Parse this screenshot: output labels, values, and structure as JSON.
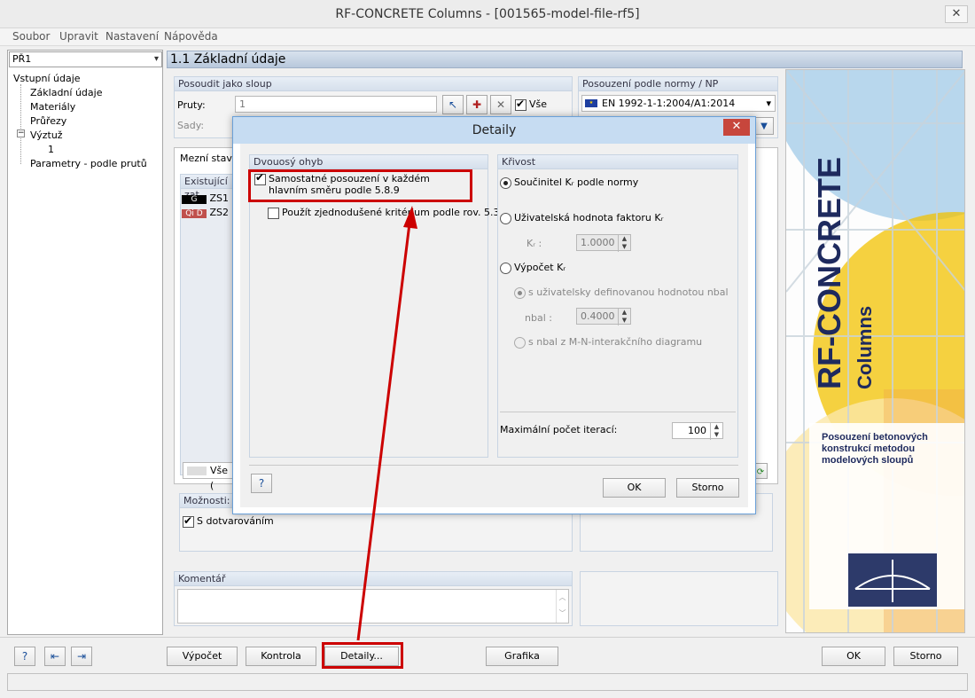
{
  "window": {
    "title": "RF-CONCRETE Columns - [001565-model-file-rf5]",
    "close_glyph": "✕"
  },
  "menu": [
    "Soubor",
    "Upravit",
    "Nastavení",
    "Nápověda"
  ],
  "left": {
    "case_select": "PŘ1",
    "tree": {
      "root": "Vstupní údaje",
      "basic": "Základní údaje",
      "materials": "Materiály",
      "sections": "Průřezy",
      "reinforcement": "Výztuž",
      "reinf_child": "1",
      "params": "Parametry - podle prutů"
    }
  },
  "main": {
    "header": "1.1 Základní údaje",
    "design_group": {
      "title": "Posoudit jako sloup",
      "members_label": "Pruty:",
      "members_value": "1",
      "sets_label": "Sady:",
      "all_label": "Vše"
    },
    "norm_group": {
      "title": "Posouzení podle normy / NP",
      "norm_value": "EN 1992-1-1:2004/A1:2014"
    },
    "tab_label": "Mezní stav ú",
    "existing_label": "Existující zat",
    "load_cases": [
      {
        "tag": "G",
        "name": "ZS1",
        "tag_color": "#000000"
      },
      {
        "tag": "Qi D",
        "name": "ZS2",
        "tag_color": "#c0504d"
      }
    ],
    "all_short": "Vše (",
    "options_title": "Možnosti:",
    "creep_label": "S dotvarováním",
    "comment_title": "Komentář"
  },
  "graphic": {
    "brand": "RF-CONCRETE",
    "sub": "Columns",
    "description": "Posouzení betonových konstrukcí metodou modelových sloupů"
  },
  "dialog": {
    "title": "Detaily",
    "close_glyph": "✕",
    "biaxial": {
      "title": "Dvouosý ohyb",
      "separate_label": "Samostatné posouzení v každém hlavním směru podle 5.8.9",
      "simplified_label": "Použít zjednodušené kritérium podle rov. 5.39"
    },
    "curvature": {
      "title": "Křivost",
      "opt1": "Součinitel Kᵣ podle normy",
      "opt2": "Uživatelská hodnota faktoru Kᵣ",
      "kr_label": "Kᵣ :",
      "kr_value": "1.0000",
      "opt3": "Výpočet Kᵣ",
      "sub1": "s uživatelsky definovanou hodnotou nbal",
      "nbal_label": "nbal :",
      "nbal_value": "0.4000",
      "sub2": "s nbal z M-N-interakčního diagramu",
      "max_iter_label": "Maximální počet iterací:",
      "max_iter_value": "100"
    },
    "ok": "OK",
    "cancel": "Storno"
  },
  "bottom": {
    "calc": "Výpočet",
    "check": "Kontrola",
    "details": "Detaily...",
    "graphics": "Grafika",
    "ok": "OK",
    "cancel": "Storno"
  },
  "colors": {
    "annotation": "#cc0000",
    "header_blue": "#b8c8dc"
  }
}
